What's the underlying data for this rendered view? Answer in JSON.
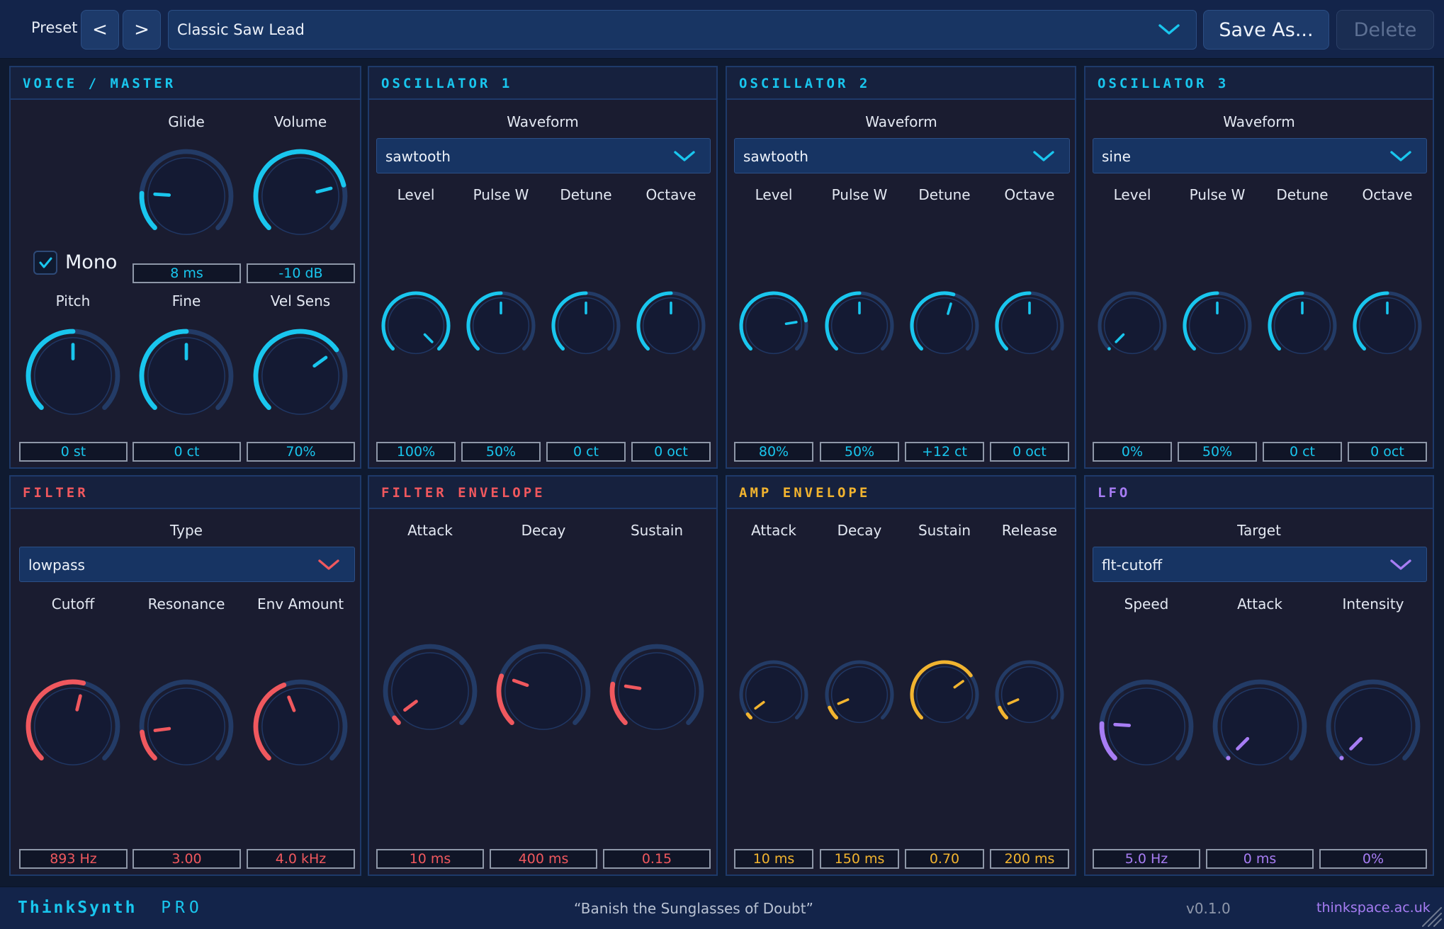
{
  "colors": {
    "cyan": "#19c6ee",
    "red": "#f0585e",
    "yellow": "#f2b42f",
    "purple": "#a77df4",
    "track": "#233b66"
  },
  "topbar": {
    "preset_label": "Preset",
    "prev_label": "<",
    "next_label": ">",
    "preset_value": "Classic Saw Lead",
    "save_label": "Save As...",
    "delete_label": "Delete"
  },
  "panels": {
    "voice": {
      "title": "VOICE / MASTER",
      "mono_label": "Mono",
      "mono_checked": true,
      "glide_label": "Glide",
      "glide_value": "8 ms",
      "glide_level": 0.18,
      "volume_label": "Volume",
      "volume_value": "-10 dB",
      "volume_level": 0.78,
      "pitch_label": "Pitch",
      "pitch_value": "0 st",
      "pitch_level": 0.5,
      "fine_label": "Fine",
      "fine_value": "0 ct",
      "fine_level": 0.5,
      "velsens_label": "Vel Sens",
      "velsens_value": "70%",
      "velsens_level": 0.7
    },
    "osc1": {
      "title": "OSCILLATOR 1",
      "waveform_label": "Waveform",
      "waveform_value": "sawtooth",
      "level_label": "Level",
      "level_value": "100%",
      "level_level": 1.0,
      "pulse_label": "Pulse W",
      "pulse_value": "50%",
      "pulse_level": 0.5,
      "detune_label": "Detune",
      "detune_value": "0 ct",
      "detune_level": 0.5,
      "octave_label": "Octave",
      "octave_value": "0 oct",
      "octave_level": 0.5
    },
    "osc2": {
      "title": "OSCILLATOR 2",
      "waveform_label": "Waveform",
      "waveform_value": "sawtooth",
      "level_label": "Level",
      "level_value": "80%",
      "level_level": 0.8,
      "pulse_label": "Pulse W",
      "pulse_value": "50%",
      "pulse_level": 0.5,
      "detune_label": "Detune",
      "detune_value": "+12 ct",
      "detune_level": 0.56,
      "octave_label": "Octave",
      "octave_value": "0 oct",
      "octave_level": 0.5
    },
    "osc3": {
      "title": "OSCILLATOR 3",
      "waveform_label": "Waveform",
      "waveform_value": "sine",
      "level_label": "Level",
      "level_value": "0%",
      "level_level": 0.0,
      "pulse_label": "Pulse W",
      "pulse_value": "50%",
      "pulse_level": 0.5,
      "detune_label": "Detune",
      "detune_value": "0 ct",
      "detune_level": 0.5,
      "octave_label": "Octave",
      "octave_value": "0 oct",
      "octave_level": 0.5
    },
    "filter": {
      "title": "FILTER",
      "type_label": "Type",
      "type_value": "lowpass",
      "cutoff_label": "Cutoff",
      "cutoff_value": "893 Hz",
      "cutoff_level": 0.55,
      "resonance_label": "Resonance",
      "resonance_value": "3.00",
      "resonance_level": 0.14,
      "envamt_label": "Env Amount",
      "envamt_value": "4.0 kHz",
      "envamt_level": 0.42
    },
    "fenv": {
      "title": "FILTER ENVELOPE",
      "attack_label": "Attack",
      "attack_value": "10 ms",
      "attack_level": 0.03,
      "decay_label": "Decay",
      "decay_value": "400 ms",
      "decay_level": 0.24,
      "sustain_label": "Sustain",
      "sustain_value": "0.15",
      "sustain_level": 0.2
    },
    "aenv": {
      "title": "AMP ENVELOPE",
      "attack_label": "Attack",
      "attack_value": "10 ms",
      "attack_level": 0.03,
      "decay_label": "Decay",
      "decay_value": "150 ms",
      "decay_level": 0.08,
      "sustain_label": "Sustain",
      "sustain_value": "0.70",
      "sustain_level": 0.7,
      "release_label": "Release",
      "release_value": "200 ms",
      "release_level": 0.08
    },
    "lfo": {
      "title": "LFO",
      "target_label": "Target",
      "target_value": "flt-cutoff",
      "speed_label": "Speed",
      "speed_value": "5.0 Hz",
      "speed_level": 0.18,
      "attack_label": "Attack",
      "attack_value": "0 ms",
      "attack_level": 0.0,
      "intensity_label": "Intensity",
      "intensity_value": "0%",
      "intensity_level": 0.0
    }
  },
  "footer": {
    "brand_name": "ThinkSynth",
    "brand_suffix": "PRO",
    "tagline": "“Banish the Sunglasses of Doubt”",
    "version": "v0.1.0",
    "link": "thinkspace.ac.uk"
  }
}
